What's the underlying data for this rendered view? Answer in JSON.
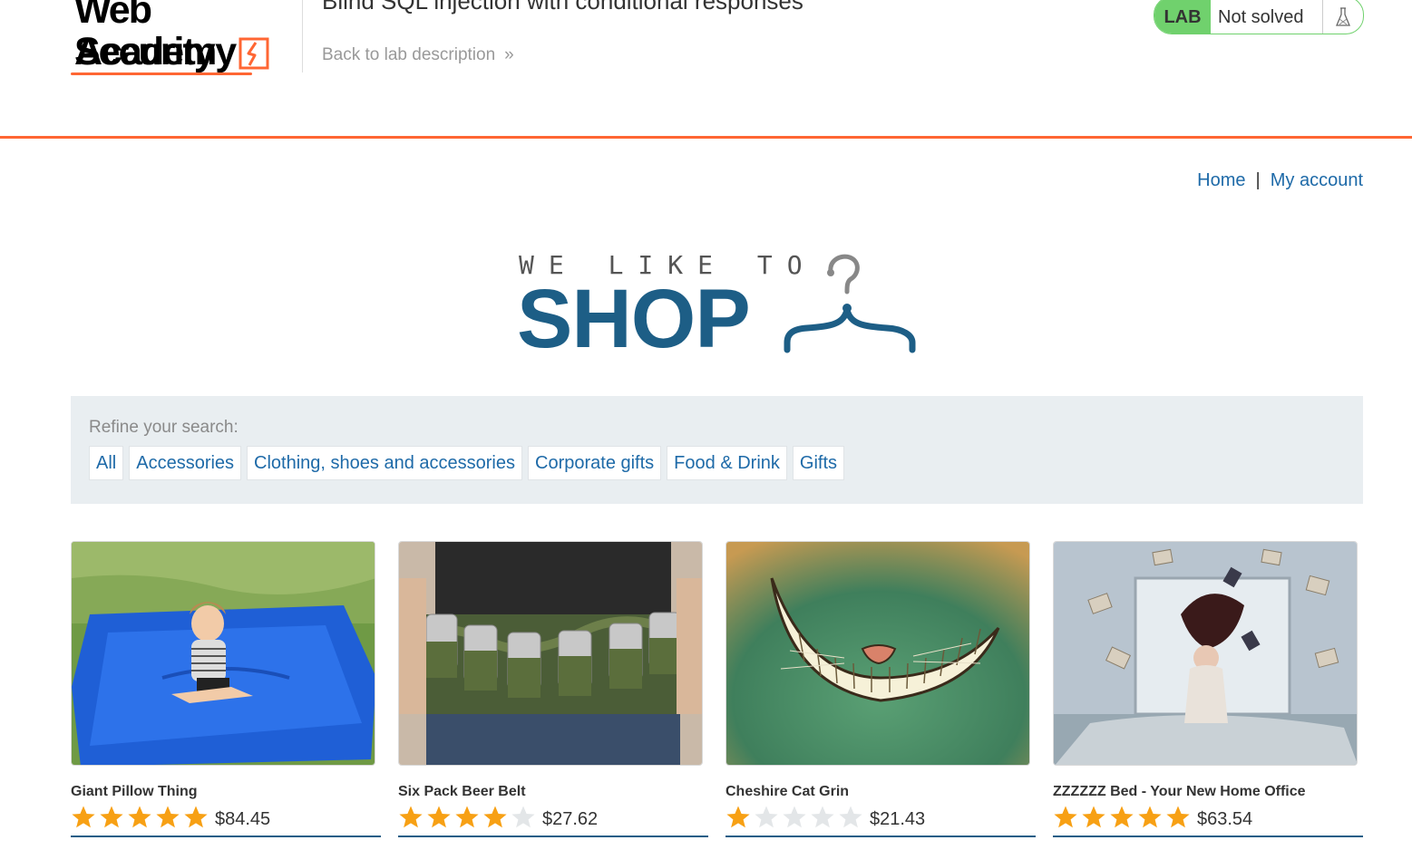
{
  "header": {
    "logo": {
      "line1": "Web Security",
      "line2": "Academy"
    },
    "lab_title": "Blind SQL injection with conditional responses",
    "back_link": "Back to lab description",
    "back_chevron": "»",
    "lab_badge": {
      "tag": "LAB",
      "status": "Not solved",
      "icon": "flask-icon"
    }
  },
  "nav": {
    "home": "Home",
    "separator": "|",
    "account": "My account"
  },
  "banner": {
    "tagline": "WE LIKE TO",
    "headline": "SHOP",
    "icon": "hanger-icon"
  },
  "filter": {
    "label": "Refine your search:",
    "categories": [
      "All",
      "Accessories",
      "Clothing, shoes and accessories",
      "Corporate gifts",
      "Food & Drink",
      "Gifts"
    ]
  },
  "products": [
    {
      "name": "Giant Pillow Thing",
      "rating": 5,
      "price": "$84.45",
      "image": "blue bean bag pillow with child on grass"
    },
    {
      "name": "Six Pack Beer Belt",
      "rating": 4,
      "price": "$27.62",
      "image": "camouflage belt holding six cans"
    },
    {
      "name": "Cheshire Cat Grin",
      "rating": 1,
      "price": "$21.43",
      "image": "cheshire cat grin illustration"
    },
    {
      "name": "ZZZZZZ Bed - Your New Home Office",
      "rating": 5,
      "price": "$63.54",
      "image": "woman on bed with flying books"
    }
  ],
  "colors": {
    "accent_orange": "#ff6633",
    "link_blue": "#1e6aa8",
    "shop_blue": "#1d5e86",
    "lab_green": "#70d16d",
    "star_filled": "#f7a014",
    "star_empty": "#e3e6e8",
    "filter_bg": "#e9eef1"
  }
}
